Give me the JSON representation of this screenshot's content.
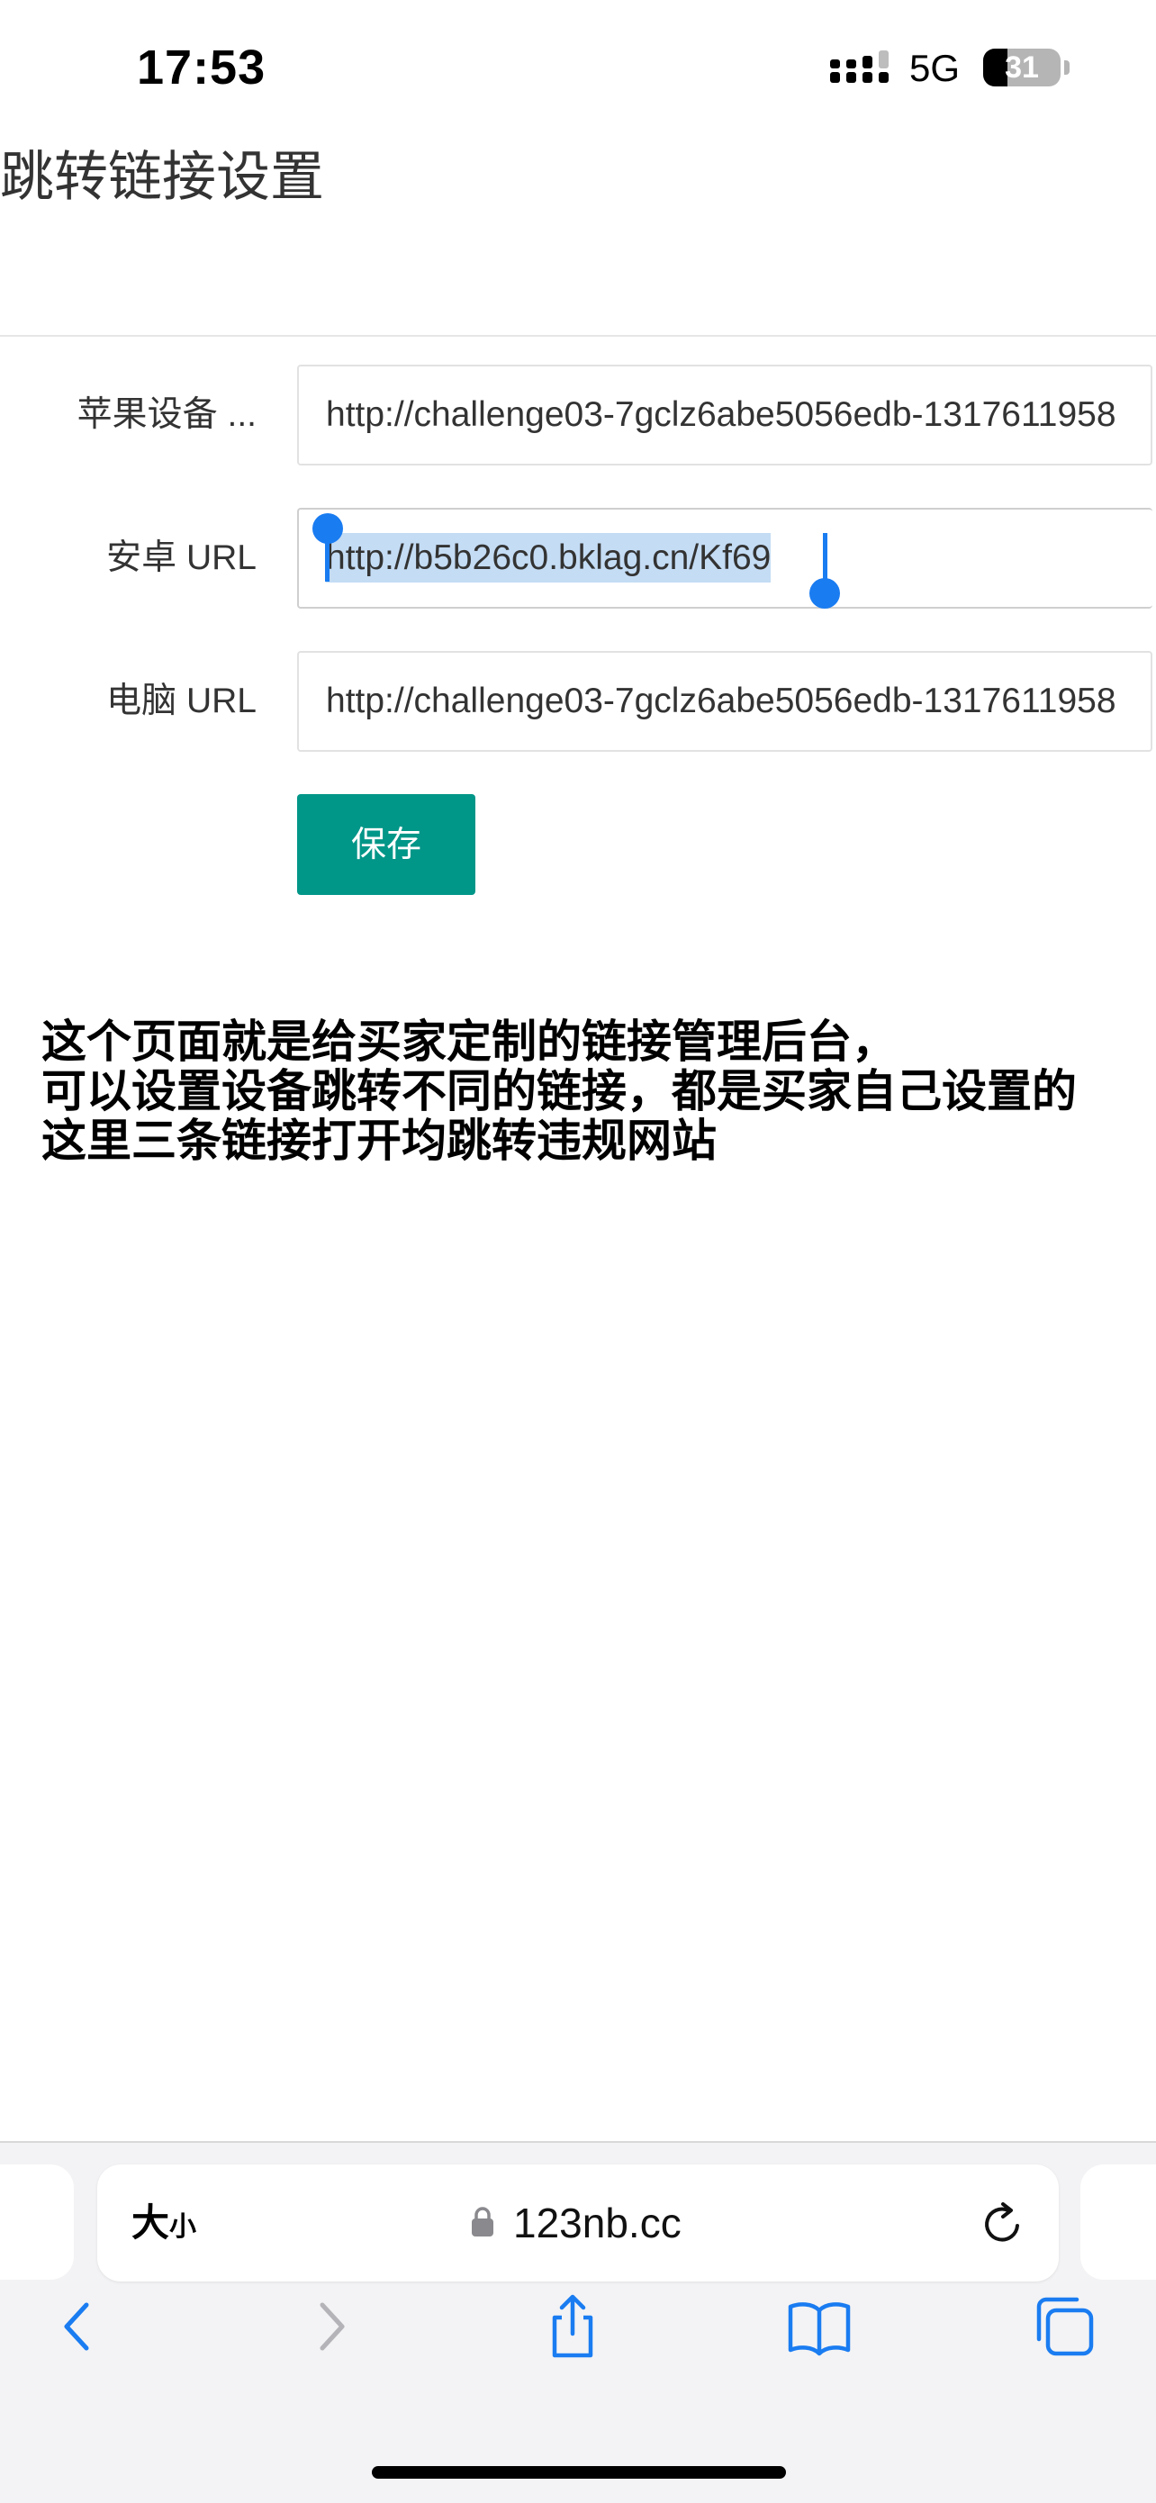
{
  "status_bar": {
    "time": "17:53",
    "network": "5G",
    "battery_level": "31",
    "battery_fraction": 0.31
  },
  "page": {
    "title": "跳转链接设置",
    "fields": [
      {
        "label": "苹果设备 ...",
        "value": "http://challenge03-7gclz6abe5056edb-1317611958"
      },
      {
        "label": "安卓 URL",
        "value": "http://b5b26c0.bklag.cn/Kf69"
      },
      {
        "label": "电脑 URL",
        "value": "http://challenge03-7gclz6abe5056edb-1317611958"
      }
    ],
    "save_label": "保存",
    "save_color": "#009688"
  },
  "annotation": {
    "lines": [
      "这个页面就是给买家定制的链接管理后台，",
      "可以设置设备跳转不同的链接，都是买家自己设置的",
      "这里三条链接打开均跳转违规网站"
    ]
  },
  "browser": {
    "text_size_big": "大",
    "text_size_small": "小",
    "domain": "123nb.cc",
    "icons": [
      "lock-icon",
      "reload-icon",
      "back-icon",
      "forward-icon",
      "share-icon",
      "bookmarks-icon",
      "tabs-icon"
    ],
    "accent": "#1a7cf1"
  }
}
